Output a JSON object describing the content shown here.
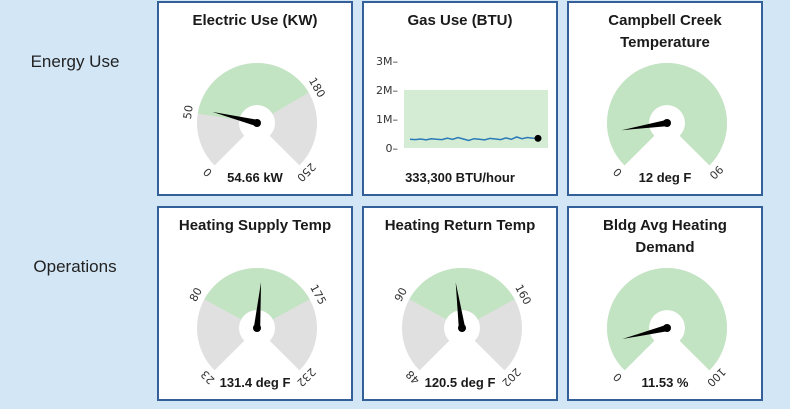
{
  "rows": {
    "energy_label": "Energy Use",
    "operations_label": "Operations"
  },
  "panels": {
    "electric": {
      "title": "Electric Use (KW)",
      "value_text": "54.66 kW",
      "gauge": {
        "min": 0,
        "max": 250,
        "value": 54.66,
        "band_low": 50,
        "band_high": 180,
        "tick_labels": [
          "0",
          "50",
          "180",
          "250"
        ]
      }
    },
    "gas": {
      "title": "Gas Use (BTU)",
      "value_text": "333,300 BTU/hour"
    },
    "campbell": {
      "title": "Campbell Creek Temperature",
      "value_text": "12 deg F",
      "gauge": {
        "min": 0,
        "max": 90,
        "value": 12,
        "band_low": 0,
        "band_high": 90,
        "tick_labels": [
          "0",
          "90"
        ]
      }
    },
    "heating_supply": {
      "title": "Heating Supply Temp",
      "value_text": "131.4 deg F",
      "gauge": {
        "min": 23,
        "max": 232,
        "value": 131.4,
        "band_low": 80,
        "band_high": 175,
        "tick_labels": [
          "23",
          "80",
          "175",
          "232"
        ]
      }
    },
    "heating_return": {
      "title": "Heating Return Temp",
      "value_text": "120.5 deg F",
      "gauge": {
        "min": 48,
        "max": 202,
        "value": 120.5,
        "band_low": 90,
        "band_high": 160,
        "tick_labels": [
          "48",
          "90",
          "160",
          "202"
        ]
      }
    },
    "bldg": {
      "title": "Bldg Avg Heating Demand",
      "value_text": "11.53 %",
      "gauge": {
        "min": 0,
        "max": 100,
        "value": 11.53,
        "band_low": 0,
        "band_high": 100,
        "tick_labels": [
          "0",
          "100"
        ]
      }
    }
  },
  "chart_data": {
    "type": "line",
    "title": "Gas Use (BTU)",
    "ylim": [
      0,
      3000000
    ],
    "yticks": [
      "0",
      "1M",
      "2M",
      "3M"
    ],
    "band": [
      0,
      2000000
    ],
    "x": [
      1,
      2,
      3,
      4,
      5,
      6,
      7,
      8,
      9,
      10,
      11,
      12,
      13,
      14,
      15,
      16,
      17,
      18,
      19,
      20,
      21,
      22,
      23,
      24,
      25
    ],
    "series": [
      {
        "values": [
          300000,
          290000,
          310000,
          280000,
          320000,
          300000,
          290000,
          340000,
          300000,
          360000,
          310000,
          260000,
          320000,
          300000,
          280000,
          330000,
          310000,
          290000,
          350000,
          300000,
          380000,
          320000,
          360000,
          340000,
          333300
        ]
      }
    ],
    "colors": {
      "line": "#2a7ab8",
      "band": "#d4ecd4",
      "last_point": "#000000"
    }
  },
  "colors": {
    "page_bg": "#d2e6f6",
    "panel_border": "#34609a",
    "gauge_gray": "#e0e0e0",
    "gauge_green": "#c3e4c3",
    "needle": "#000000"
  }
}
